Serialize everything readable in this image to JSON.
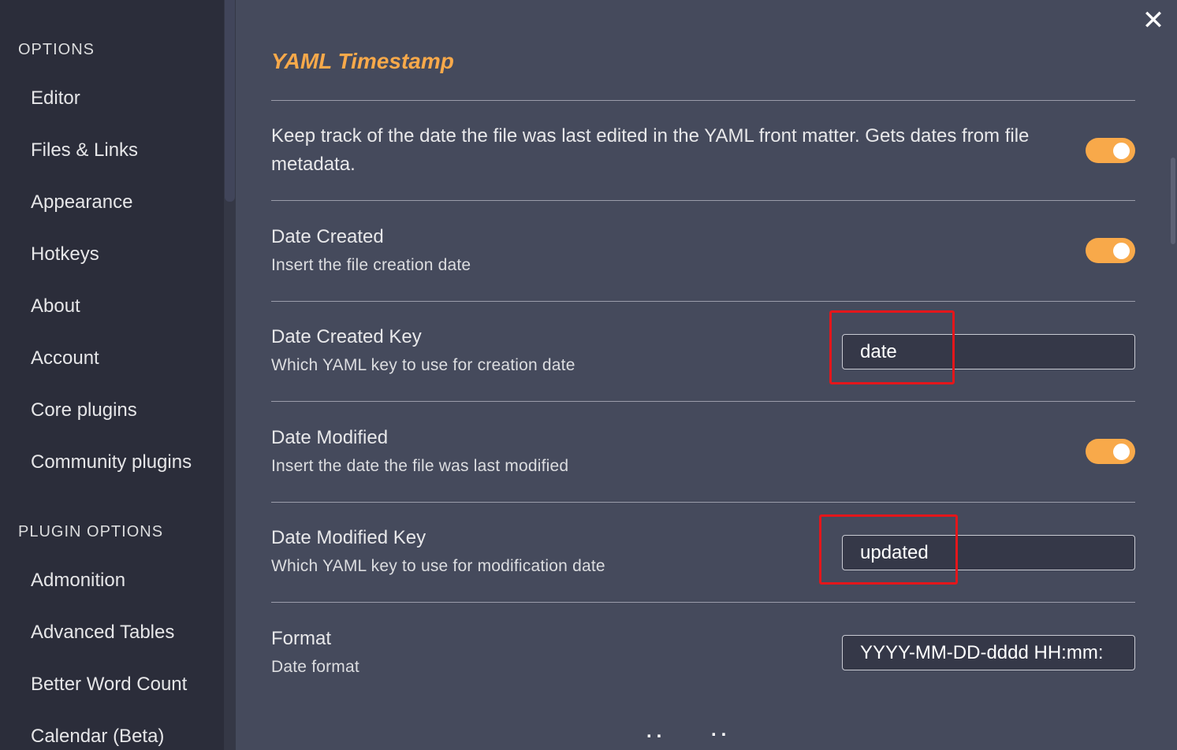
{
  "sidebar": {
    "options_heading": "OPTIONS",
    "options": [
      {
        "label": "Editor"
      },
      {
        "label": "Files & Links"
      },
      {
        "label": "Appearance"
      },
      {
        "label": "Hotkeys"
      },
      {
        "label": "About"
      },
      {
        "label": "Account"
      },
      {
        "label": "Core plugins"
      },
      {
        "label": "Community plugins"
      }
    ],
    "plugin_heading": "PLUGIN OPTIONS",
    "plugins": [
      {
        "label": "Admonition"
      },
      {
        "label": "Advanced Tables"
      },
      {
        "label": "Better Word Count"
      },
      {
        "label": "Calendar (Beta)"
      }
    ]
  },
  "main": {
    "title": "YAML Timestamp",
    "close_icon": "close-icon",
    "settings": {
      "enable": {
        "description": "Keep track of the date the file was last edited in the YAML front matter. Gets dates from file metadata.",
        "enabled": true
      },
      "date_created": {
        "name": "Date Created",
        "description": "Insert the file creation date",
        "enabled": true
      },
      "date_created_key": {
        "name": "Date Created Key",
        "description": "Which YAML key to use for creation date",
        "value": "date"
      },
      "date_modified": {
        "name": "Date Modified",
        "description": "Insert the date the file was last modified",
        "enabled": true
      },
      "date_modified_key": {
        "name": "Date Modified Key",
        "description": "Which YAML key to use for modification date",
        "value": "updated"
      },
      "format": {
        "name": "Format",
        "description": "Date format",
        "value": "YYYY-MM-DD-dddd HH:mm:"
      }
    },
    "bottom_dots_left": "..",
    "bottom_dots_right": ".."
  },
  "colors": {
    "accent": "#f8a94a",
    "highlight": "#e4161b",
    "sidebar_bg": "#2b2d3a",
    "main_bg": "#454a5c"
  }
}
